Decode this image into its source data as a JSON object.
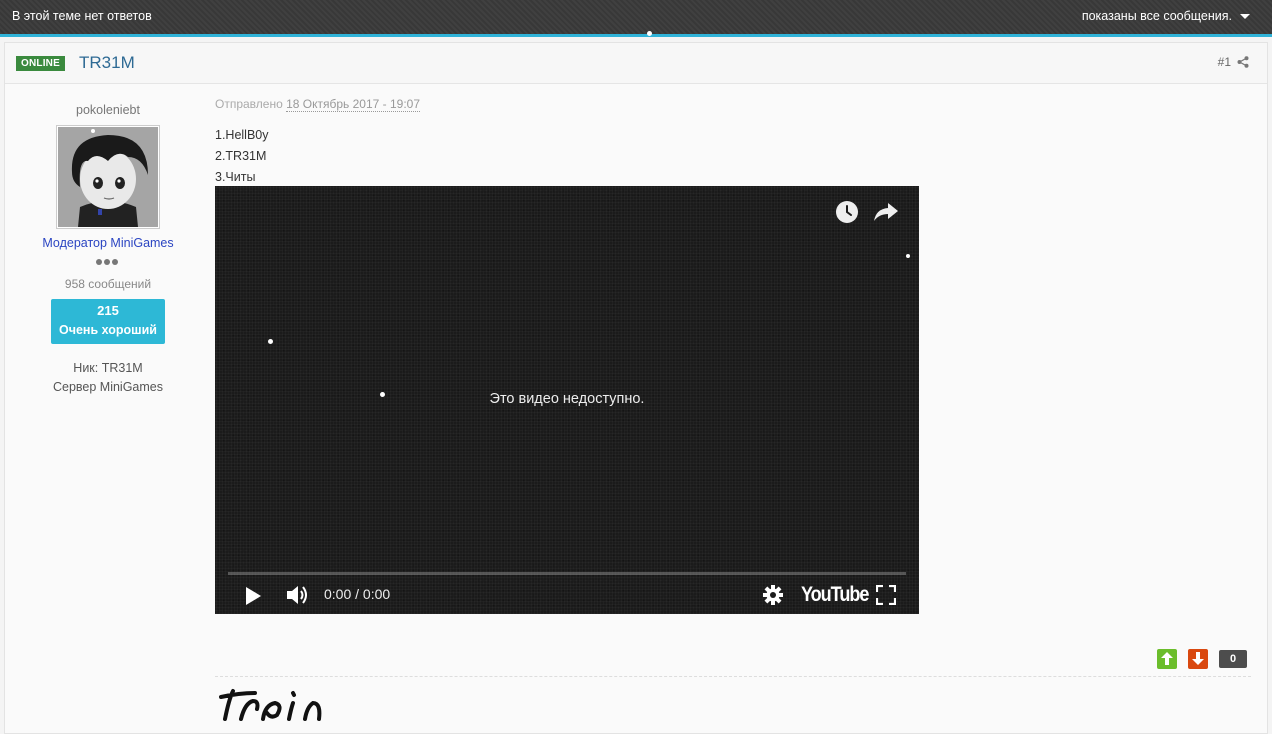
{
  "topbar": {
    "status_text": "В этой теме нет ответов",
    "filter_label": "показаны все сообщения."
  },
  "post": {
    "badge": "ONLINE",
    "author": "TR31M",
    "number": "#1",
    "posted_prefix": "Отправлено",
    "posted_date": "18 Октябрь 2017 - 19:07",
    "lines": [
      "1.HellB0y",
      "2.TR31M",
      "3.Читы"
    ]
  },
  "author_info": {
    "username": "pokoleniebt",
    "group": "Модератор MiniGames",
    "post_count": "958 сообщений",
    "rep_value": "215",
    "rep_label": "Очень хороший",
    "nick": "Ник: TR31M",
    "server": "Сервер MiniGames"
  },
  "video": {
    "message": "Это видео недоступно.",
    "time": "0:00 / 0:00",
    "logo": "YouTube"
  },
  "votes": {
    "count": "0"
  },
  "colors": {
    "accent": "#2fb3d8",
    "online": "#3a8a3e",
    "author_link": "#2e6a94",
    "group": "#2b45c2",
    "vote_up": "#6bbd2b",
    "vote_down": "#d9480f"
  }
}
